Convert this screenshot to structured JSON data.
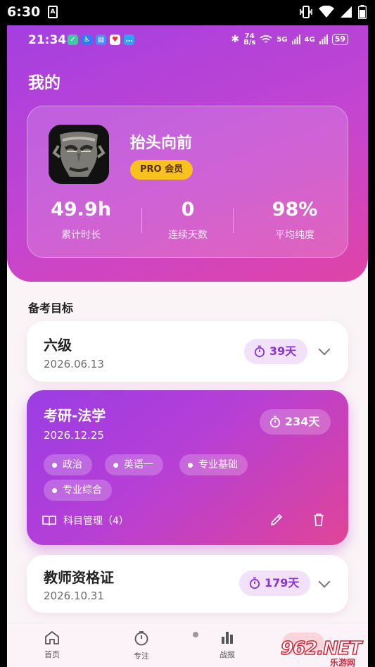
{
  "system": {
    "time": "6:30",
    "notification_glyph": "A"
  },
  "inner_status": {
    "time": "21:34",
    "net_speed_top": "74",
    "net_speed_bottom": "B/s",
    "sig1": "5G",
    "sig2": "4G",
    "battery": "59"
  },
  "page": {
    "title": "我的"
  },
  "profile": {
    "username": "抬头向前",
    "badge": "PRO 会员",
    "stats": [
      {
        "value": "49.9h",
        "label": "累计时长"
      },
      {
        "value": "0",
        "label": "连续天数"
      },
      {
        "value": "98%",
        "label": "平均纯度"
      }
    ]
  },
  "section_title": "备考目标",
  "goals": [
    {
      "name": "六级",
      "date": "2026.06.13",
      "days": "39天"
    },
    {
      "name": "考研-法学",
      "date": "2026.12.25",
      "days": "234天",
      "subjects": [
        "政治",
        "英语一",
        "专业基础",
        "专业综合"
      ],
      "manage_label": "科目管理（4）"
    },
    {
      "name": "教师资格证",
      "date": "2026.10.31",
      "days": "179天"
    }
  ],
  "nav": [
    {
      "label": "首页",
      "icon": "home-icon"
    },
    {
      "label": "专注",
      "icon": "timer-icon"
    },
    {
      "label": "战报",
      "icon": "bar-chart-icon"
    }
  ],
  "watermark": {
    "brand": "962.NET",
    "sub": "乐游网"
  },
  "colors": {
    "accent": "#a43fe0",
    "pink": "#e044a7",
    "badge": "#f7c21d"
  }
}
